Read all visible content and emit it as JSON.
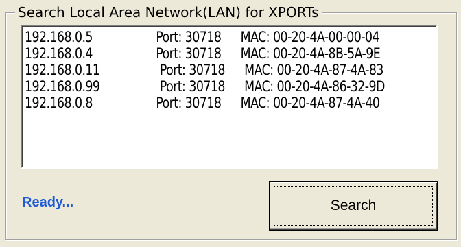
{
  "group": {
    "title": "Search Local Area Network(LAN) for XPORTs"
  },
  "devices": [
    {
      "ip": "192.168.0.5",
      "port": "Port: 30718",
      "mac": "MAC: 00-20-4A-00-00-04"
    },
    {
      "ip": "192.168.0.4",
      "port": "Port: 30718",
      "mac": "MAC: 00-20-4A-8B-5A-9E"
    },
    {
      "ip": "192.168.0.11",
      "port": "Port: 30718",
      "mac": "MAC: 00-20-4A-87-4A-83"
    },
    {
      "ip": "192.168.0.99",
      "port": "Port: 30718",
      "mac": "MAC: 00-20-4A-86-32-9D"
    },
    {
      "ip": "192.168.0.8",
      "port": "Port: 30718",
      "mac": "MAC: 00-20-4A-87-4A-40"
    }
  ],
  "status": {
    "text": "Ready...",
    "color": "#1f5bd6"
  },
  "search_button": {
    "label": "Search"
  }
}
